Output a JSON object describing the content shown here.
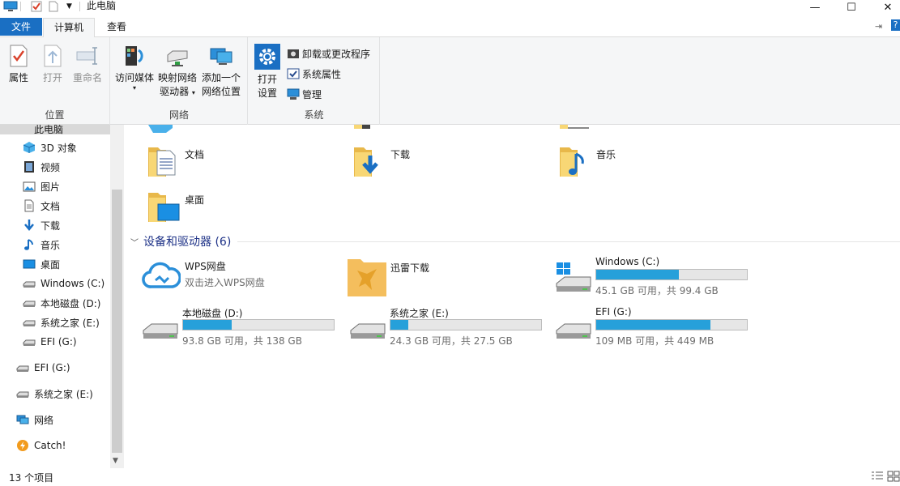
{
  "window": {
    "title": "此电脑",
    "minimize": "—",
    "maximize": "☐",
    "close": "✕"
  },
  "tabs": {
    "file": "文件",
    "computer": "计算机",
    "view": "查看"
  },
  "ribbon": {
    "location": {
      "label": "位置",
      "properties": "属性",
      "open": "打开",
      "rename": "重命名"
    },
    "network": {
      "label": "网络",
      "access_media": "访问媒体",
      "map_drive_line1": "映射网络",
      "map_drive_line2": "驱动器",
      "add_location_line1": "添加一个",
      "add_location_line2": "网络位置"
    },
    "system": {
      "label": "系统",
      "open_settings_line1": "打开",
      "open_settings_line2": "设置",
      "uninstall": "卸载或更改程序",
      "system_properties": "系统属性",
      "manage": "管理"
    }
  },
  "sidebar": {
    "this_pc": "此电脑",
    "items": [
      {
        "label": "3D 对象",
        "icon": "3d-objects-icon"
      },
      {
        "label": "视频",
        "icon": "videos-icon"
      },
      {
        "label": "图片",
        "icon": "pictures-icon"
      },
      {
        "label": "文档",
        "icon": "documents-icon"
      },
      {
        "label": "下载",
        "icon": "downloads-icon"
      },
      {
        "label": "音乐",
        "icon": "music-icon"
      },
      {
        "label": "桌面",
        "icon": "desktop-icon"
      },
      {
        "label": "Windows (C:)",
        "icon": "drive-icon"
      },
      {
        "label": "本地磁盘 (D:)",
        "icon": "drive-icon"
      },
      {
        "label": "系统之家 (E:)",
        "icon": "drive-icon"
      },
      {
        "label": "EFI (G:)",
        "icon": "drive-icon"
      }
    ],
    "roots": [
      {
        "label": "EFI (G:)",
        "icon": "drive-icon"
      },
      {
        "label": "系统之家 (E:)",
        "icon": "drive-icon"
      },
      {
        "label": "网络",
        "icon": "network-icon"
      },
      {
        "label": "Catch!",
        "icon": "catch-icon"
      }
    ]
  },
  "content": {
    "folders": [
      {
        "name": "文档",
        "icon": "documents-folder-icon"
      },
      {
        "name": "下载",
        "icon": "downloads-folder-icon"
      },
      {
        "name": "音乐",
        "icon": "music-folder-icon"
      },
      {
        "name": "桌面",
        "icon": "desktop-folder-icon"
      }
    ],
    "devices_header": "设备和驱动器 (6)",
    "apps": [
      {
        "name": "WPS网盘",
        "subtitle": "双击进入WPS网盘",
        "icon": "wps-cloud-icon"
      },
      {
        "name": "迅雷下载",
        "icon": "xunlei-icon"
      }
    ],
    "drives": [
      {
        "name": "Windows (C:)",
        "info": "45.1 GB 可用，共 99.4 GB",
        "used_fraction": 0.546
      },
      {
        "name": "本地磁盘 (D:)",
        "info": "93.8 GB 可用，共 138 GB",
        "used_fraction": 0.32
      },
      {
        "name": "系统之家 (E:)",
        "info": "24.3 GB 可用，共 27.5 GB",
        "used_fraction": 0.116
      },
      {
        "name": "EFI (G:)",
        "info": "109 MB 可用，共 449 MB",
        "used_fraction": 0.757
      }
    ]
  },
  "status": {
    "item_count": "13 个项目"
  },
  "colors": {
    "accent": "#1a6fc3",
    "drive_bar": "#26a0da",
    "folder": "#f8d775"
  }
}
